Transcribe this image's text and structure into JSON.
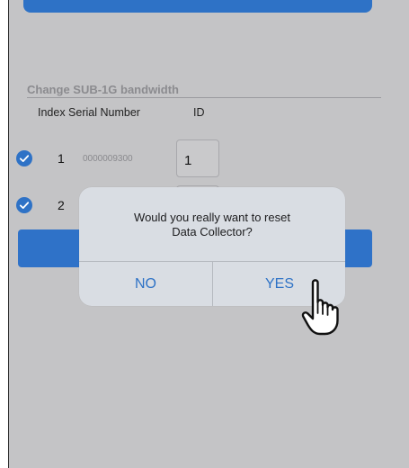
{
  "section": {
    "title": "Change SUB-1G bandwidth"
  },
  "table": {
    "headers": {
      "index_serial": "Index Serial Number",
      "id": "ID"
    },
    "rows": [
      {
        "index": "1",
        "serial": "0000009300",
        "id": "1"
      },
      {
        "index": "2",
        "serial": "",
        "id": ""
      }
    ]
  },
  "dialog": {
    "message_line1": "Would you really want to reset",
    "message_line2": "Data Collector?",
    "no_label": "NO",
    "yes_label": "YES"
  },
  "colors": {
    "accent": "#2e72c6",
    "background": "#c4c4c6",
    "dialog": "#d9dde3"
  },
  "icons": {
    "check": "check-icon",
    "cursor": "hand-pointer-icon"
  }
}
